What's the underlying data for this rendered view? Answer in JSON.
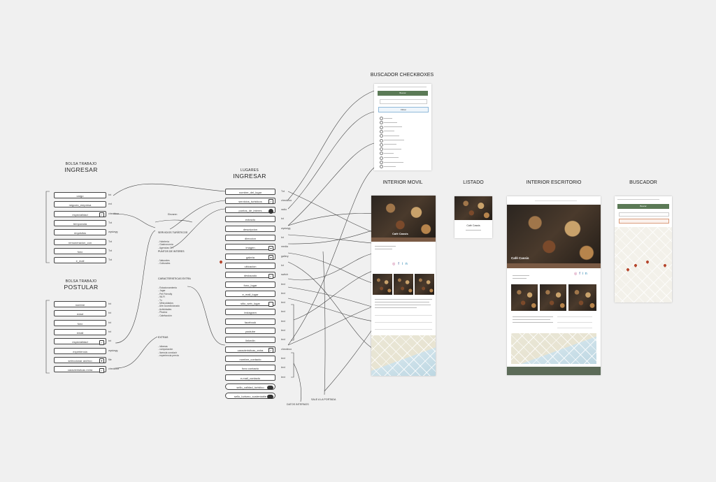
{
  "colors": {
    "background": "#f0f0f0",
    "wire": "#444444",
    "accent_green": "#5b7a56",
    "accent_brown": "#7a5a44",
    "pin": "#b5452c"
  },
  "bolsa_ingresar": {
    "title_small": "BOLSA TRABAJO",
    "title_big": "INGRESAR",
    "fields": [
      {
        "label": "cargo",
        "type": "txt"
      },
      {
        "label": "negocio_empresa",
        "type": "ext"
      },
      {
        "label": "especialidad",
        "type": "checkbox"
      },
      {
        "label": "temporada",
        "type": "Txt"
      },
      {
        "label": "requisitos",
        "type": "wysiwyg"
      },
      {
        "label": "remuneracion_con",
        "type": "Txt"
      },
      {
        "label": "fono",
        "type": "Txt"
      },
      {
        "label": "e_mail",
        "type": "Txt"
      }
    ]
  },
  "bolsa_postular": {
    "title_small": "BOLSA TRABAJO",
    "title_big": "POSTULAR",
    "fields": [
      {
        "label": "nombre",
        "type": "txt"
      },
      {
        "label": "edad",
        "type": "txt"
      },
      {
        "label": "fono",
        "type": "txt"
      },
      {
        "label": "email",
        "type": "txt"
      },
      {
        "label": "especialidad",
        "type": "txt"
      },
      {
        "label": "experiencia",
        "type": "wysiwyg"
      },
      {
        "label": "seleccionar archivo",
        "type": "file"
      },
      {
        "label": "caracteristicas extra",
        "type": "checkbox"
      }
    ]
  },
  "notes": {
    "elevaren": "Elevaren",
    "servicios_title": "SERVICIOS TURÍSTICOS",
    "servicios": "- Hotelería\n- Gastronomía\n- Agencias OIT",
    "puntos_title": "PUNTOS DE INTERES",
    "puntos": "- Naturales\n- Culturales",
    "caracteristicas_title": "CARACTERISTICAS EXTRA",
    "caracteristicas": "- Estacionamiento\n- Jugar\n- Pet Friendly\n- Wi-Fi\n- Tv\n- Minicuidados\n- Aire Acondicionado\n- Actividades\n- Piscina\n- Calefacción",
    "extras_title": "EXTRAS",
    "extras": "- idiomas\n- computación\n- licencia conducir\n- experiencia previa",
    "datos_internos": "DATOS INTERNOS",
    "sale_portada": "SALE A LA PORTADA"
  },
  "lugares": {
    "title_small": "LUGARES",
    "title_big": "INGRESAR",
    "fields": [
      {
        "label": "nombre_del_lugar",
        "type": "Txt"
      },
      {
        "label": "servicios_turisticos",
        "type": "checkbox"
      },
      {
        "label": "puntos_de_interes",
        "type": "radio"
      },
      {
        "label": "extracto",
        "type": "txt"
      },
      {
        "label": "descripcion",
        "type": "wysiwyg"
      },
      {
        "label": "direccion",
        "type": "txt"
      },
      {
        "label": "imagen",
        "type": "media"
      },
      {
        "label": "galeria",
        "type": "gallery"
      },
      {
        "label": "ubicacion",
        "type": "txt"
      },
      {
        "label": "destacado",
        "type": "switch"
      },
      {
        "label": "fono_lugar",
        "type": "text"
      },
      {
        "label": "e_mail_lugar",
        "type": "text"
      },
      {
        "label": "sitio_web_lugar",
        "type": "text"
      },
      {
        "label": "instagram",
        "type": "text"
      },
      {
        "label": "facebook",
        "type": "text"
      },
      {
        "label": "youtube",
        "type": "text"
      },
      {
        "label": "linkedin",
        "type": "text"
      },
      {
        "label": "caracteristicas_extra",
        "type": "checkbox"
      },
      {
        "label": "nombre_contacto",
        "type": "text"
      },
      {
        "label": "fono contacto",
        "type": "text"
      },
      {
        "label": "e-mail_contacto",
        "type": "text"
      },
      {
        "label": "sello_calidad_turistico",
        "type": ""
      },
      {
        "label": "sello_turismo_sustentable",
        "type": ""
      }
    ]
  },
  "screens": {
    "buscador_checkboxes": {
      "title": "BUSCADOR CHECKBOXES",
      "button": "Buscar",
      "filter": "Filtrar"
    },
    "interior_movil": {
      "title": "INTERIOR MOVIL",
      "place": "Café Cassis"
    },
    "listado": {
      "title": "LISTADO",
      "place": "Café Cassis"
    },
    "interior_escritorio": {
      "title": "INTERIOR ESCRITORIO",
      "place": "Café Cassis"
    },
    "buscador": {
      "title": "BUSCADOR",
      "button": "Buscar"
    }
  }
}
